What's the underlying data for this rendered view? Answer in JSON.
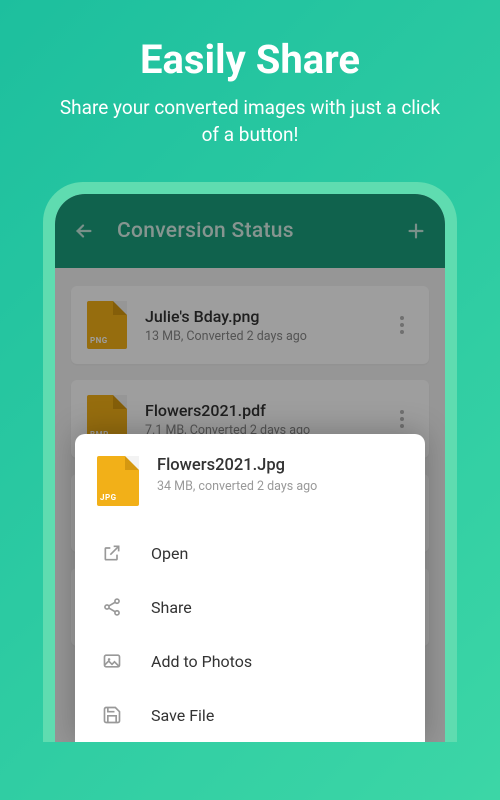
{
  "promo": {
    "title": "Easily Share",
    "subtitle": "Share your converted images with just a click of a button!"
  },
  "app_bar": {
    "title": "Conversion Status"
  },
  "files": [
    {
      "name": "Julie's Bday.png",
      "meta": "13 MB, Converted 2 days ago",
      "ext": "PNG"
    },
    {
      "name": "Flowers2021.pdf",
      "meta": "7.1 MB, Converted 2 days ago",
      "ext": "BMP"
    }
  ],
  "sheet": {
    "name": "Flowers2021.Jpg",
    "meta": "34 MB, converted 2 days ago",
    "ext": "JPG",
    "items": [
      {
        "id": "open",
        "label": "Open"
      },
      {
        "id": "share",
        "label": "Share"
      },
      {
        "id": "add-photos",
        "label": "Add to Photos"
      },
      {
        "id": "save-file",
        "label": "Save File"
      }
    ]
  }
}
